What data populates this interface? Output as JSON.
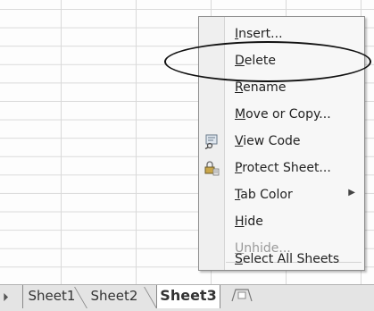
{
  "grid": {
    "description_hidden": ""
  },
  "tabs": {
    "nav_arrow": "⏵",
    "items": [
      "Sheet1",
      "Sheet2",
      "Sheet3"
    ],
    "insert_icon": "insert-sheet-icon"
  },
  "context_menu": {
    "items": [
      {
        "label": "Insert...",
        "underline": "I"
      },
      {
        "label": "Delete",
        "underline": "D"
      },
      {
        "label": "Rename",
        "underline": "R"
      },
      {
        "label": "Move or Copy...",
        "underline": "M"
      },
      {
        "label": "View Code",
        "underline": "V",
        "icon": "view-code-icon"
      },
      {
        "label": "Protect Sheet...",
        "underline": "P",
        "icon": "protect-sheet-icon"
      },
      {
        "label": "Tab Color",
        "underline": "T",
        "submenu": true
      },
      {
        "label": "Hide",
        "underline": "H"
      },
      {
        "label": "Unhide...",
        "underline": "U",
        "disabled": true
      },
      {
        "label": "Select All Sheets",
        "underline": "S"
      }
    ]
  },
  "colors": {
    "highlight": "#111111",
    "menu_bg": "#f7f7f7"
  }
}
